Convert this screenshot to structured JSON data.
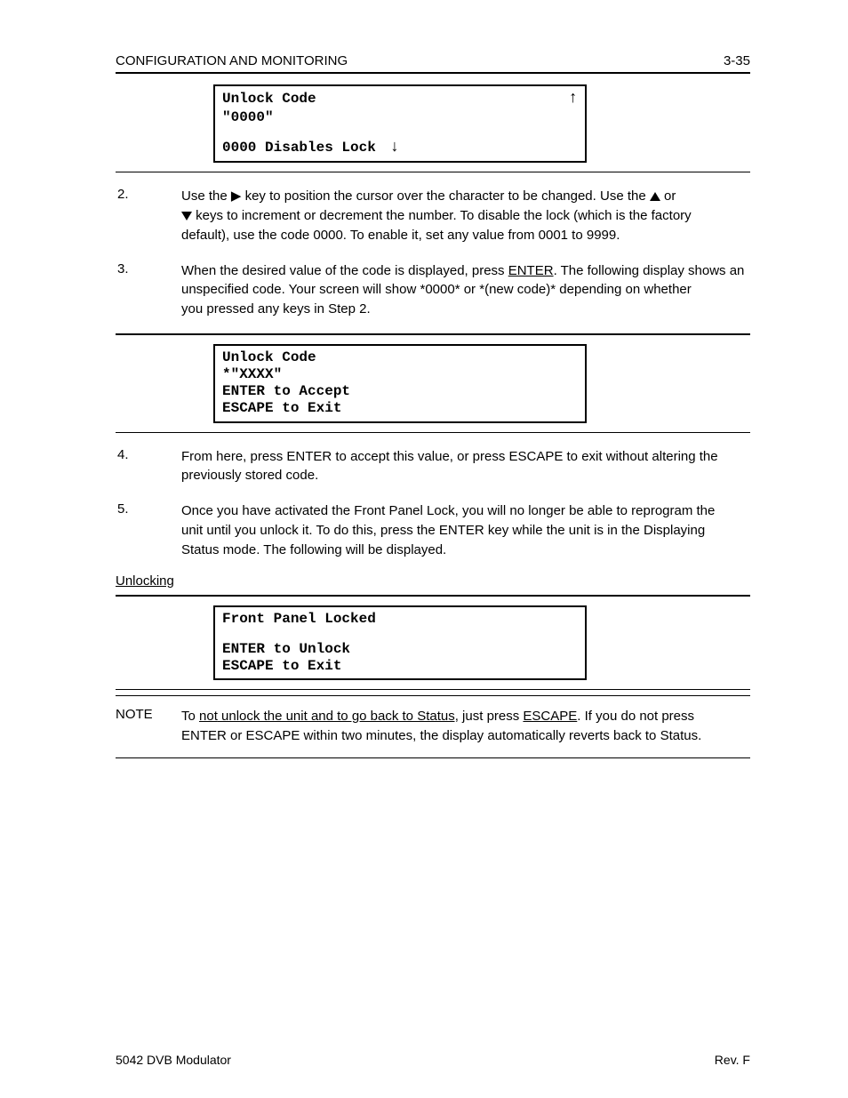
{
  "header": {
    "left": "CONFIGURATION AND MONITORING",
    "right": "3-35"
  },
  "lcd1": {
    "l1": "Unlock Code",
    "l2": "\"0000\"",
    "l3": "0000 Disables Lock"
  },
  "steps_block1": {
    "s2_label": "2.",
    "s2": {
      "l1_a": "Use the ",
      "l1_b": " key to position the cursor over the character to be changed. Use the ",
      "l1_c": " or",
      "l2_a": " keys to increment or decrement the number. To disable the lock (which is the factory",
      "l2_b": "default), use the code 0000. To enable it, set any value from 0001 to 9999."
    },
    "s3_label": "3.",
    "s3": {
      "l1_a": "When the desired value of the code is displayed, press ",
      "l1_b": "ENTER",
      "l1_c": ". The following display shows an",
      "l2_a": "unspecified code. Your screen will show ",
      "l2_b": "*0000*",
      "l2_c": " or ",
      "l2_d": "*(new code)*",
      "l2_e": " depending on whether",
      "l3": "you pressed any keys in Step 2."
    }
  },
  "lcd2": {
    "l1": "Unlock Code",
    "l2": "*\"XXXX\"",
    "l3": "ENTER to Accept",
    "l4": "ESCAPE to Exit"
  },
  "steps_block2": {
    "s4_label": "4.",
    "s4": {
      "l1_a": "From here, press ",
      "l1_b": "ENTER",
      "l1_c": " to accept this value, or press ",
      "l1_d": "ESCAPE",
      "l1_e": " to exit without altering the",
      "l2": "previously stored code."
    },
    "s5_label": "5.",
    "s5": {
      "l1_a": "Once you have activated the Front Panel Lock, you will no longer be able to reprogram the",
      "l1_b": "unit until you unlock it. To do this, press the ",
      "l1_c": "ENTER",
      "l1_d": " key while the unit is in the Displaying",
      "l2": "Status mode. The following will be displayed."
    }
  },
  "unlock_heading": "Unlocking",
  "lcd3": {
    "l1": "Front Panel Locked",
    "l2": "ENTER to Unlock",
    "l3": "ESCAPE to Exit"
  },
  "note": {
    "label": "NOTE",
    "l1_a": "To ",
    "l1_b": "not",
    "l1_c": " unlock the unit and to go back to Status,",
    "l1_d": " just press ",
    "l1_e": "ESCAPE",
    "l1_f": ". If you do not press",
    "l2_a": "ENTER",
    "l2_b": " or ",
    "l2_c": "ESCAPE",
    "l2_d": " within two minutes, the display automatically reverts back to Status."
  },
  "footer": {
    "left": "5042 DVB Modulator",
    "right": "Rev. F"
  }
}
